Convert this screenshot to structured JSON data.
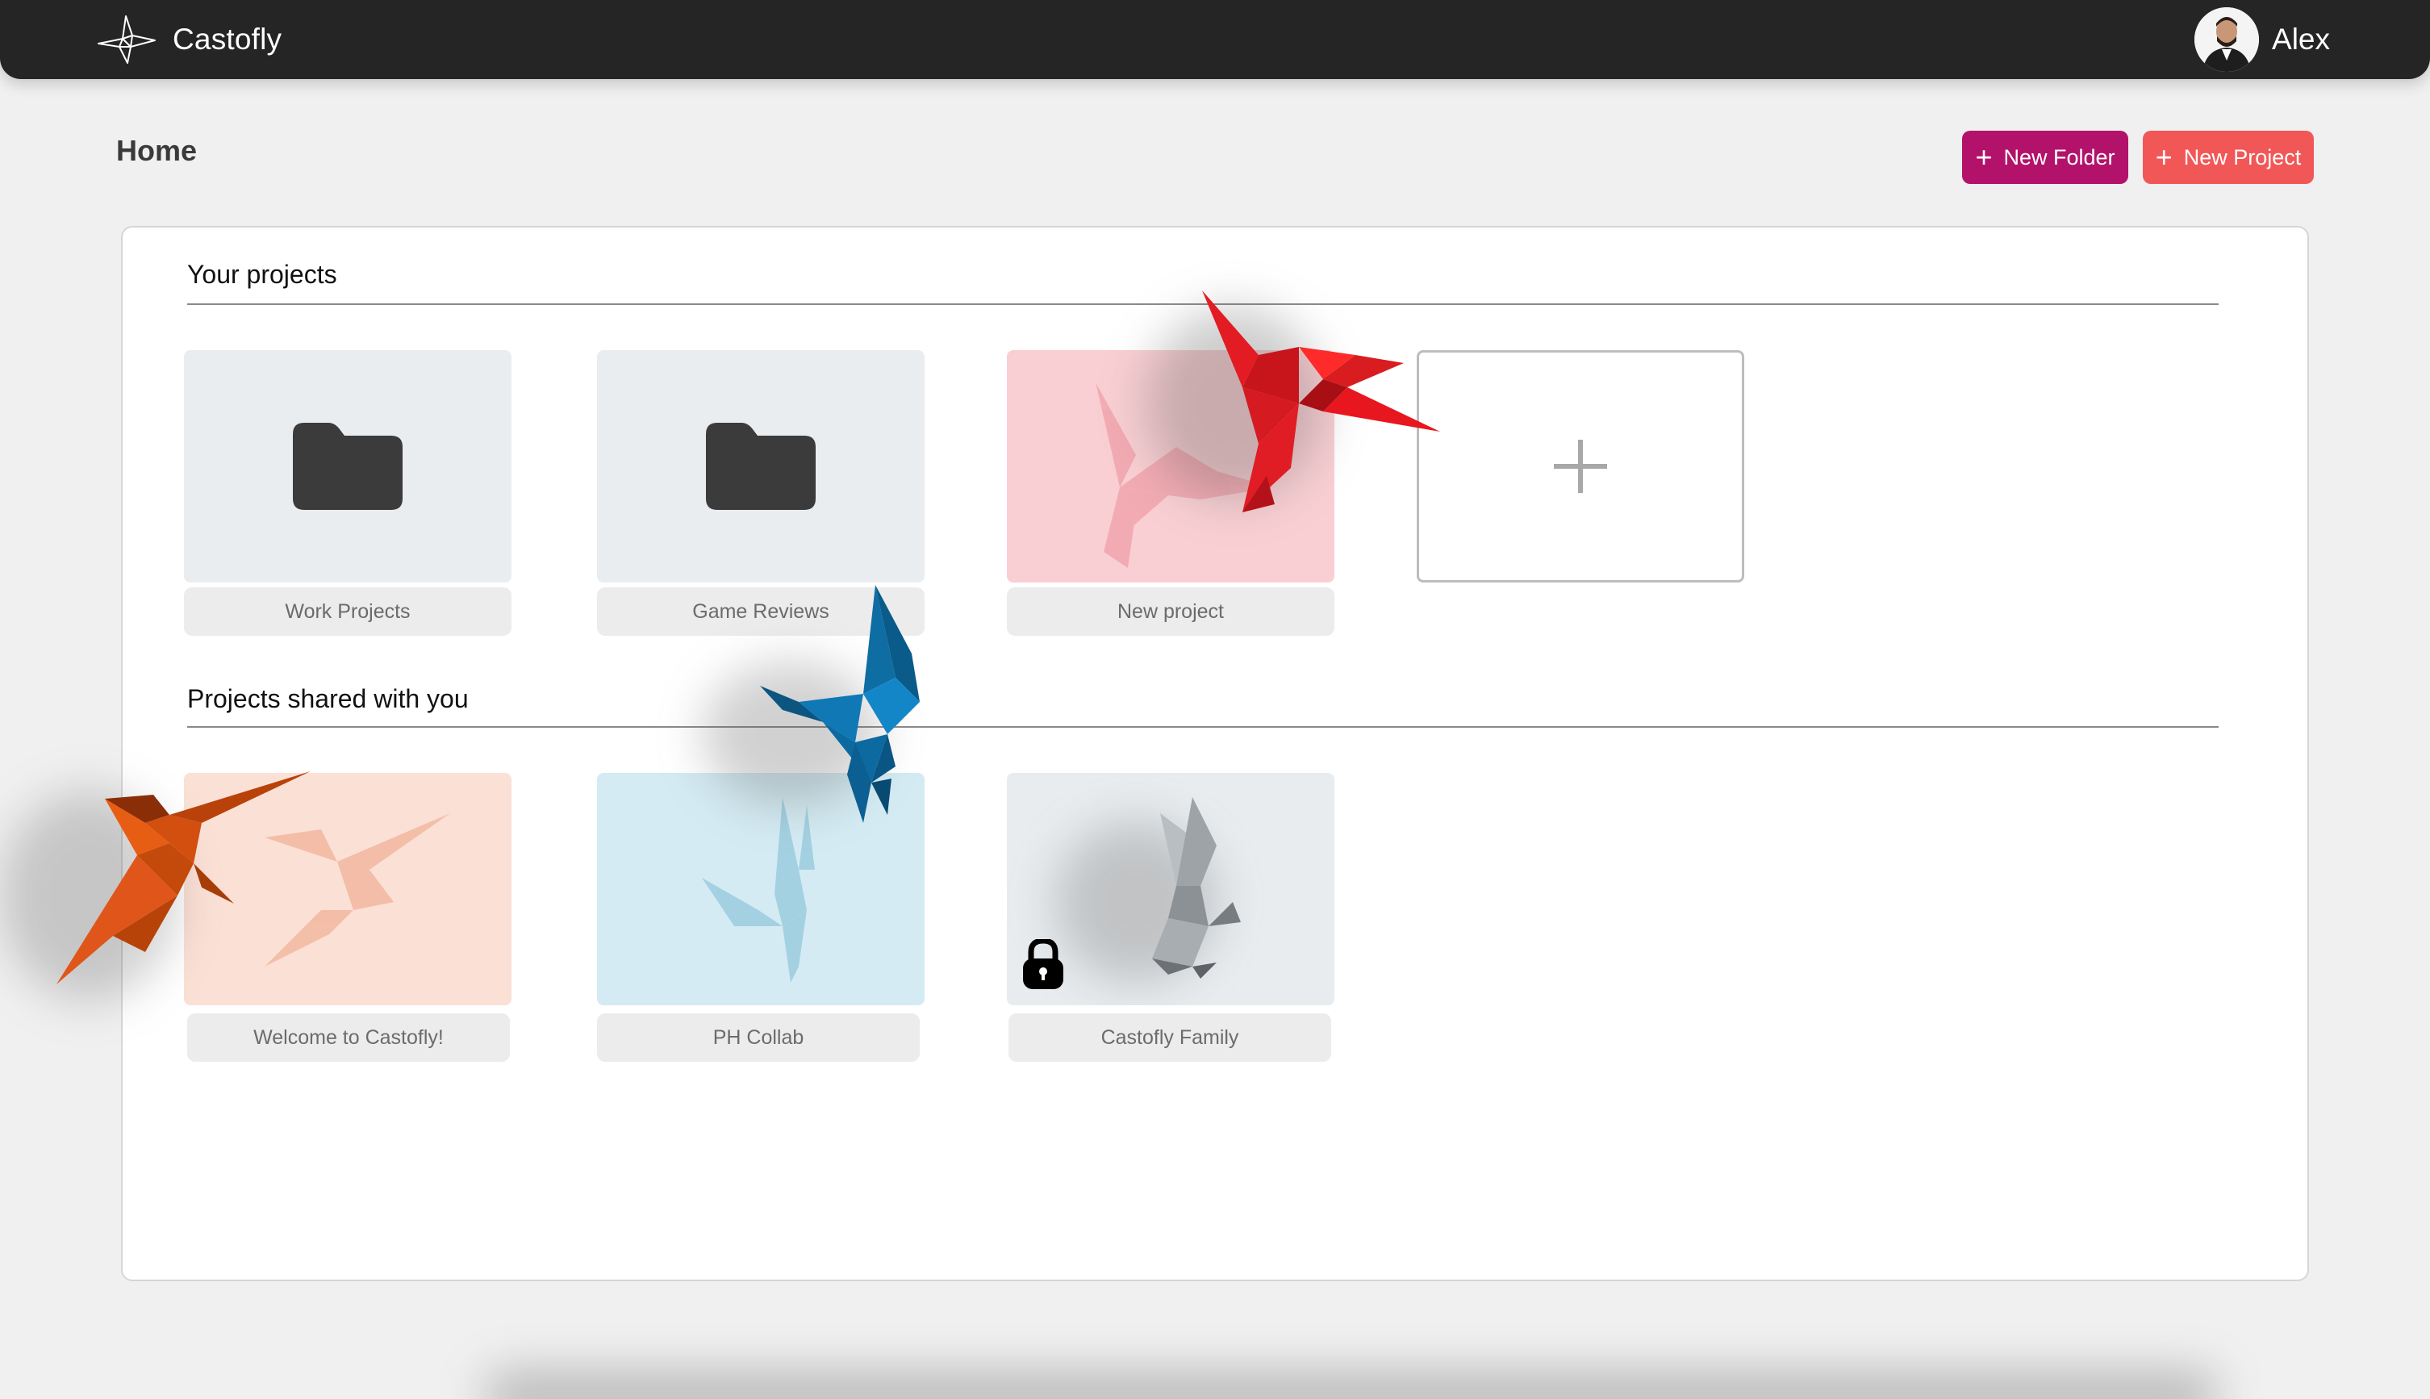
{
  "app": {
    "name": "Castofly",
    "user_name": "Alex"
  },
  "header": {
    "title": "Home",
    "new_folder_label": "New Folder",
    "new_project_label": "New Project",
    "new_folder_color": "#b3126a",
    "new_project_color": "#f25757"
  },
  "sections": {
    "own": {
      "title": "Your projects",
      "items": [
        {
          "label": "Work Projects",
          "type": "folder"
        },
        {
          "label": "Game Reviews",
          "type": "folder"
        },
        {
          "label": "New project",
          "type": "project",
          "color": "#f9cfd3"
        }
      ],
      "add_icon": "plus-icon"
    },
    "shared": {
      "title": "Projects shared with you",
      "items": [
        {
          "label": "Welcome to Castofly!",
          "type": "project",
          "color": "#fbe0d6"
        },
        {
          "label": "PH Collab",
          "type": "project",
          "color": "#d4ebf3"
        },
        {
          "label": "Castofly Family",
          "type": "project",
          "color": "#e8ecef",
          "locked": true
        }
      ]
    }
  },
  "icons": {
    "logo": "origami-bird-logo-icon",
    "avatar": "user-avatar-icon",
    "folder": "folder-icon",
    "plus": "plus-icon",
    "lock": "lock-icon"
  }
}
